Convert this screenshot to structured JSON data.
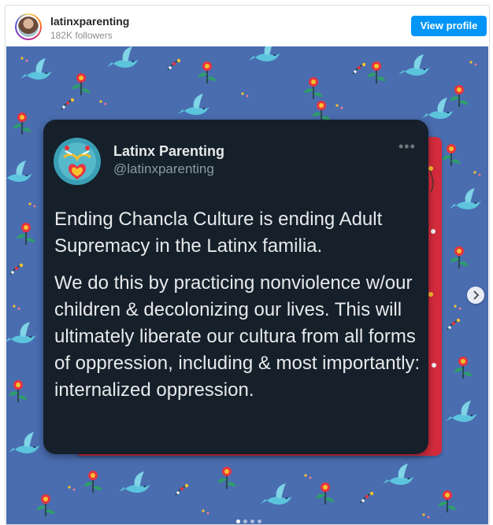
{
  "header": {
    "username": "latinxparenting",
    "followers": "182K followers",
    "view_profile_label": "View profile"
  },
  "tweet": {
    "display_name": "Latinx Parenting",
    "handle": "@latinxparenting",
    "more_label": "•••",
    "paragraph_1": "Ending Chancla Culture is ending Adult Supremacy in the Latinx familia.",
    "paragraph_2": "We do this by practicing nonviolence w/our children & decolonizing our lives. This will ultimately liberate our cultura from all forms of oppression, including & most importantly: internalized oppression."
  },
  "carousel": {
    "slide_count": 4,
    "active_slide": 1
  },
  "colors": {
    "brand_button": "#0095f6",
    "background_blue": "#4a6db0",
    "tweet_card": "#15202b",
    "red_frame": "#d42b3c",
    "bird": "#5cc4dc"
  },
  "icons": {
    "next": "chevron-right-icon",
    "more": "more-horizontal-icon",
    "avatar": "avatar-icon"
  }
}
